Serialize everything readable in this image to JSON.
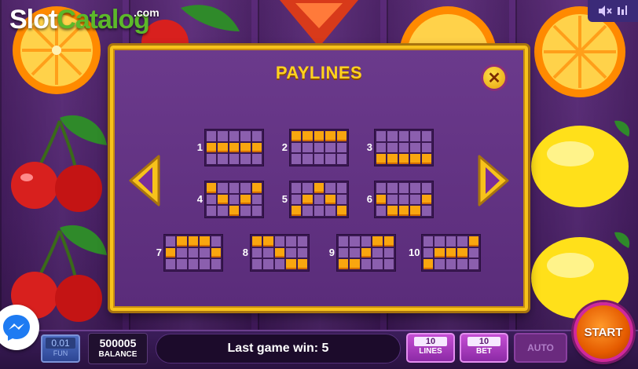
{
  "logo": {
    "part1": "Slot",
    "part2": "Catalog",
    "suffix": ".com"
  },
  "sound": {
    "icon": "speaker-mute-icon",
    "settings_icon": "equalizer-icon"
  },
  "reels": {
    "symbols": [
      "orange",
      "cherry",
      "cherry",
      "seven",
      "orange",
      "orange",
      "lemon",
      "lemon"
    ]
  },
  "modal": {
    "title": "PAYLINES",
    "close_icon": "close-icon",
    "prev_icon": "triangle-left-icon",
    "next_icon": "triangle-right-icon",
    "paylines": [
      {
        "number": "1",
        "pattern": [
          1,
          1,
          1,
          1,
          1
        ]
      },
      {
        "number": "2",
        "pattern": [
          0,
          0,
          0,
          0,
          0
        ]
      },
      {
        "number": "3",
        "pattern": [
          2,
          2,
          2,
          2,
          2
        ]
      },
      {
        "number": "4",
        "pattern": [
          0,
          1,
          2,
          1,
          0
        ]
      },
      {
        "number": "5",
        "pattern": [
          2,
          1,
          0,
          1,
          2
        ]
      },
      {
        "number": "6",
        "pattern": [
          1,
          2,
          2,
          2,
          1
        ]
      },
      {
        "number": "7",
        "pattern": [
          1,
          0,
          0,
          0,
          1
        ]
      },
      {
        "number": "8",
        "pattern": [
          0,
          0,
          1,
          2,
          2
        ]
      },
      {
        "number": "9",
        "pattern": [
          2,
          2,
          1,
          0,
          0
        ]
      },
      {
        "number": "10",
        "pattern": [
          2,
          1,
          1,
          1,
          0
        ]
      }
    ]
  },
  "bottom": {
    "coin_value": "0.01",
    "coin_label": "FUN",
    "balance_value": "500005",
    "balance_label": "BALANCE",
    "message": "Last game win: 5",
    "lines_value": "10",
    "lines_label": "LINES",
    "bet_value": "10",
    "bet_label": "BET",
    "auto_label": "AUTO",
    "start_label": "START",
    "messenger_icon": "messenger-icon"
  },
  "colors": {
    "frame_gold": "#f7c21b",
    "payline_on": "#f9a60f",
    "payline_off": "#8b5fae",
    "title_yellow": "#ffd21f",
    "start_orange": "#e55b00"
  }
}
